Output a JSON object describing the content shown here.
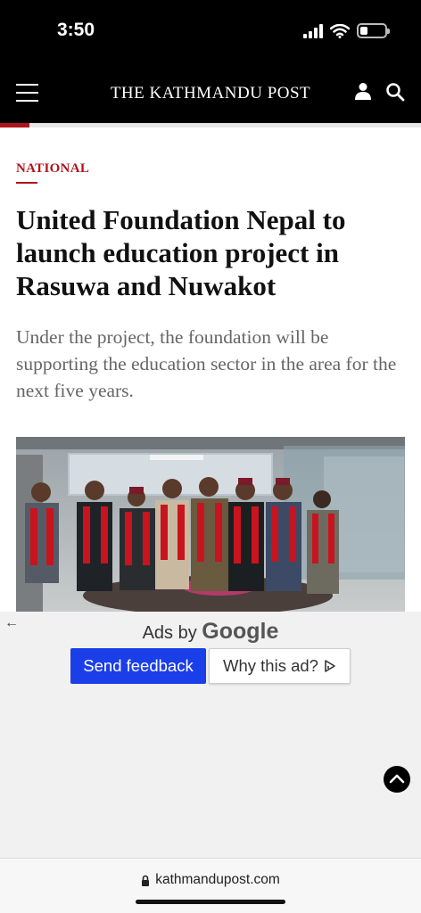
{
  "status": {
    "time": "3:50"
  },
  "header": {
    "logo": "THE KATHMANDU POST"
  },
  "reading_progress": 0.07,
  "article": {
    "category": "NATIONAL",
    "headline": "United Foundation Nepal to launch education project in Rasuwa and Nuwakot",
    "summary": "Under the project, the foundation will be supporting the education sector in the area for the next five years."
  },
  "ad": {
    "ads_by": "Ads by",
    "brand": "Google",
    "feedback_label": "Send feedback",
    "why_label": "Why this ad?"
  },
  "browser": {
    "url": "kathmandupost.com"
  },
  "colors": {
    "accent": "#b0141b",
    "header_bg": "#000000",
    "ad_button": "#1a3ee8"
  },
  "icons": [
    "menu-icon",
    "user-icon",
    "search-icon",
    "back-arrow-icon",
    "adchoices-icon",
    "chevron-up-icon",
    "lock-icon"
  ]
}
